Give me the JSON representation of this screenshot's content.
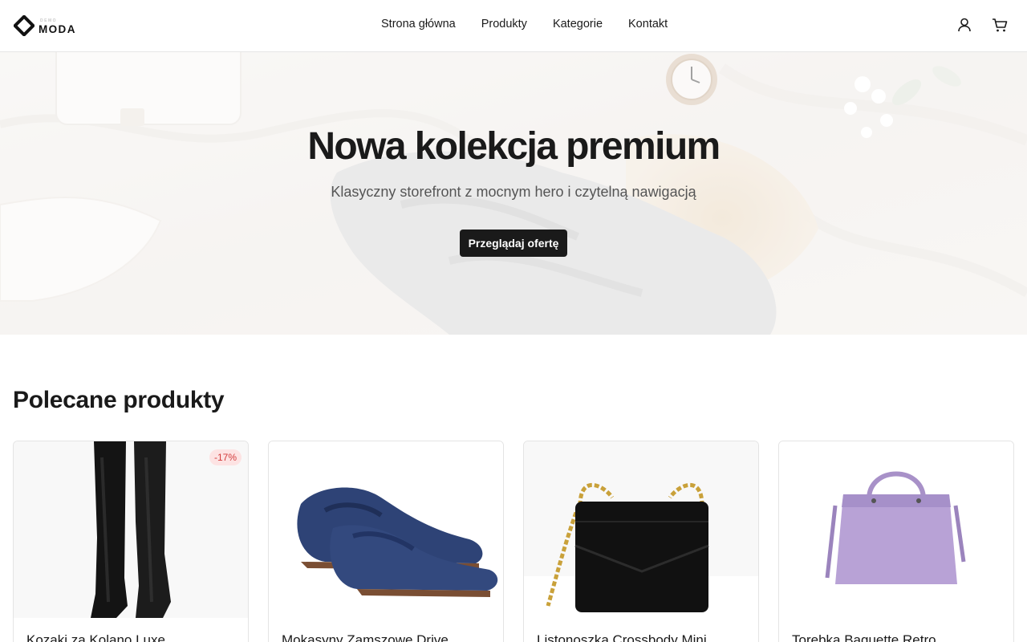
{
  "brand": {
    "small": "DEMO",
    "name": "MODA"
  },
  "nav": {
    "items": [
      {
        "label": "Strona główna"
      },
      {
        "label": "Produkty"
      },
      {
        "label": "Kategorie"
      },
      {
        "label": "Kontakt"
      }
    ]
  },
  "header_icons": {
    "account": "user-icon",
    "cart": "cart-icon"
  },
  "hero": {
    "title": "Nowa kolekcja premium",
    "subtitle": "Klasyczny storefront z mocnym hero i czytelną nawigacją",
    "cta": "Przeglądaj ofertę"
  },
  "featured": {
    "title": "Polecane produkty",
    "products": [
      {
        "name": "Kozaki za Kolano Luxe",
        "badge": "-17%",
        "image": "black-knee-boots"
      },
      {
        "name": "Mokasyny Zamszowe Drive",
        "image": "navy-suede-loafers"
      },
      {
        "name": "Listonoszka Crossbody Mini",
        "image": "black-chain-crossbody-bag"
      },
      {
        "name": "Torebka Baguette Retro",
        "image": "lilac-handbag"
      }
    ]
  },
  "colors": {
    "primary": "#1a1a1a",
    "badge_bg": "#fde3e3",
    "badge_text": "#d33c3c"
  }
}
